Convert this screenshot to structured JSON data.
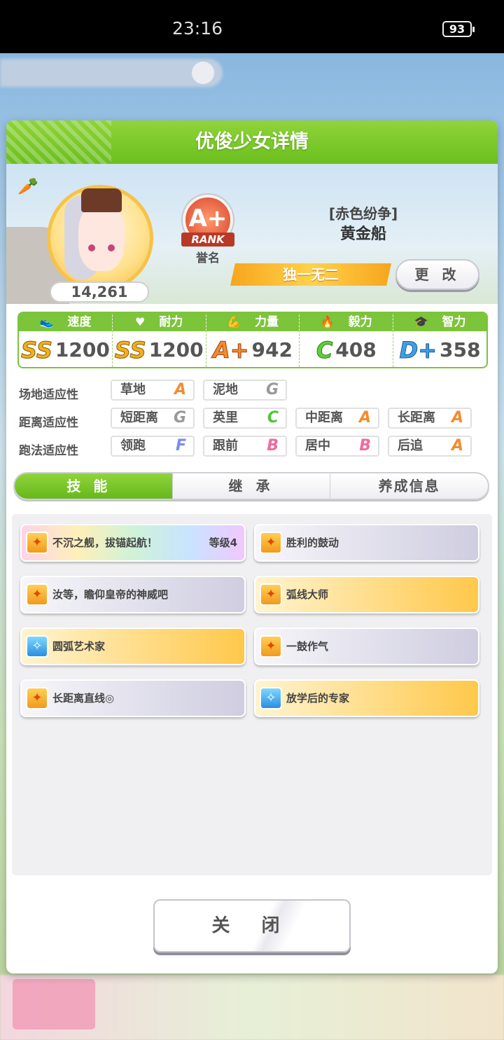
{
  "status_bar": {
    "time": "23:16",
    "battery": "93"
  },
  "dialog": {
    "title": "优俊少女详情",
    "fans": "14,261",
    "rank": {
      "grade": "A+",
      "ribbon": "RANK",
      "name": "誉名"
    },
    "character": {
      "title": "[赤色纷争]",
      "name": "黄金船"
    },
    "unique_label": "独一无二",
    "change_label": "更 改",
    "stats": [
      {
        "label": "速度",
        "icon": "shoe-icon",
        "grade": "SS",
        "value": "1200"
      },
      {
        "label": "耐力",
        "icon": "heart-icon",
        "grade": "SS",
        "value": "1200"
      },
      {
        "label": "力量",
        "icon": "muscle-icon",
        "grade": "A+",
        "value": "942"
      },
      {
        "label": "毅力",
        "icon": "flame-icon",
        "grade": "C",
        "value": "408"
      },
      {
        "label": "智力",
        "icon": "graduation-cap-icon",
        "grade": "D+",
        "value": "358"
      }
    ],
    "aptitude": {
      "field_label": "场地适应性",
      "distance_label": "距离适应性",
      "style_label": "跑法适应性",
      "field": [
        {
          "name": "草地",
          "grade": "A"
        },
        {
          "name": "泥地",
          "grade": "G"
        }
      ],
      "distance": [
        {
          "name": "短距离",
          "grade": "G"
        },
        {
          "name": "英里",
          "grade": "C"
        },
        {
          "name": "中距离",
          "grade": "A"
        },
        {
          "name": "长距离",
          "grade": "A"
        }
      ],
      "style": [
        {
          "name": "领跑",
          "grade": "F"
        },
        {
          "name": "跟前",
          "grade": "B"
        },
        {
          "name": "居中",
          "grade": "B"
        },
        {
          "name": "后追",
          "grade": "A"
        }
      ]
    },
    "tabs": [
      "技能",
      "继 承",
      "养成信息"
    ],
    "skills": [
      {
        "name": "不沉之舰，拔锚起航！",
        "level": "等级4",
        "style": "rainbow",
        "icon": "speed-skill-icon"
      },
      {
        "name": "胜利的鼓动",
        "style": "gray",
        "icon": "speed-skill-icon"
      },
      {
        "name": "汝等，瞻仰皇帝的神威吧",
        "style": "gray",
        "icon": "speed-skill-icon"
      },
      {
        "name": "弧线大师",
        "style": "gold",
        "icon": "speed-skill-icon"
      },
      {
        "name": "圆弧艺术家",
        "style": "gold",
        "icon": "recovery-skill-icon"
      },
      {
        "name": "一鼓作气",
        "style": "gray",
        "icon": "speed-skill-icon"
      },
      {
        "name": "长距离直线◎",
        "style": "gray",
        "icon": "speed-skill-icon"
      },
      {
        "name": "放学后的专家",
        "style": "gold",
        "icon": "recovery-skill-icon"
      }
    ],
    "close_label": "关 闭"
  }
}
